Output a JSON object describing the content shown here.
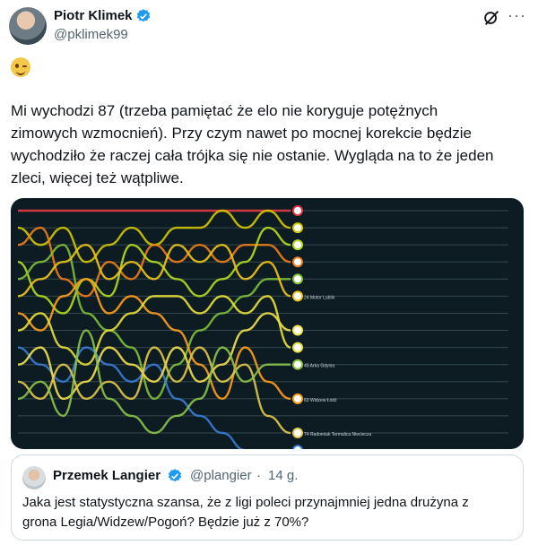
{
  "tweet": {
    "author_name": "Piotr Klimek",
    "handle": "@pklimek99",
    "emoji": "winking-face",
    "text": "Mi wychodzi 87 (trzeba pamiętać że elo nie koryguje potężnych\nzimowych wzmocnień). Przy czym nawet po mocnej korekcie będzie\nwychodziło że raczej cała trójka się nie ostanie. Wygląda na to że jeden\nzleci, więcej też wątpliwe.",
    "more_label": "···"
  },
  "colors": {
    "accent": "#1d9bf0",
    "muted": "#536471",
    "chart_bg": "#0c1c22"
  },
  "chart_data": {
    "type": "line",
    "series": [
      {
        "color": "#e63946",
        "values": [
          1,
          1,
          1,
          1,
          1,
          1,
          1,
          1,
          1,
          1,
          1,
          1,
          1
        ]
      },
      {
        "color": "#d4c800",
        "values": [
          2,
          3,
          2,
          4,
          3,
          2,
          3,
          2,
          2,
          1,
          2,
          1,
          2
        ]
      },
      {
        "color": "#ef7d1a",
        "values": [
          3,
          2,
          5,
          6,
          4,
          5,
          3,
          4,
          3,
          4,
          3,
          3,
          4
        ]
      },
      {
        "color": "#b5dc20",
        "values": [
          4,
          6,
          7,
          5,
          6,
          3,
          4,
          5,
          6,
          5,
          4,
          2,
          3
        ]
      },
      {
        "color": "#7fbf3a",
        "values": [
          5,
          4,
          3,
          7,
          8,
          9,
          12,
          10,
          8,
          7,
          6,
          5,
          5
        ]
      },
      {
        "color": "#f0c419",
        "values": [
          6,
          5,
          4,
          3,
          5,
          4,
          5,
          3,
          4,
          3,
          5,
          4,
          6
        ]
      },
      {
        "color": "#ff9f1c",
        "values": [
          7,
          8,
          6,
          5,
          7,
          6,
          7,
          8,
          10,
          12,
          9,
          11,
          12
        ]
      },
      {
        "color": "#e8e03a",
        "values": [
          8,
          7,
          9,
          10,
          8,
          7,
          6,
          6,
          7,
          6,
          7,
          6,
          9
        ]
      },
      {
        "color": "#3a7bd5",
        "values": [
          9,
          10,
          11,
          9,
          10,
          11,
          10,
          12,
          13,
          14,
          15,
          16,
          15
        ]
      },
      {
        "color": "#f4e04d",
        "values": [
          10,
          9,
          12,
          11,
          9,
          10,
          11,
          9,
          11,
          10,
          8,
          7,
          8
        ]
      },
      {
        "color": "#e2c84a",
        "values": [
          11,
          12,
          10,
          12,
          11,
          12,
          9,
          11,
          9,
          11,
          10,
          13,
          14
        ]
      },
      {
        "color": "#8bc34a",
        "values": [
          12,
          11,
          13,
          8,
          12,
          13,
          14,
          13,
          12,
          9,
          11,
          10,
          10
        ]
      }
    ],
    "team_labels": [
      "",
      "",
      "",
      "",
      "",
      "24 Motor Lublin",
      "",
      "",
      "",
      "45 Arka Gdynia",
      "",
      "63 Widzew Łódź",
      "",
      "74 Radomiak Termalica Nieciecza"
    ],
    "gridlines": 13
  },
  "quote": {
    "author_name": "Przemek Langier",
    "handle": "@plangier",
    "separator": "·",
    "time": "14 g.",
    "text": "Jaka jest statystyczna szansa, że z ligi poleci przynajmniej jedna drużyna z\ngrona Legia/Widzew/Pogoń? Będzie już z 70%?"
  }
}
